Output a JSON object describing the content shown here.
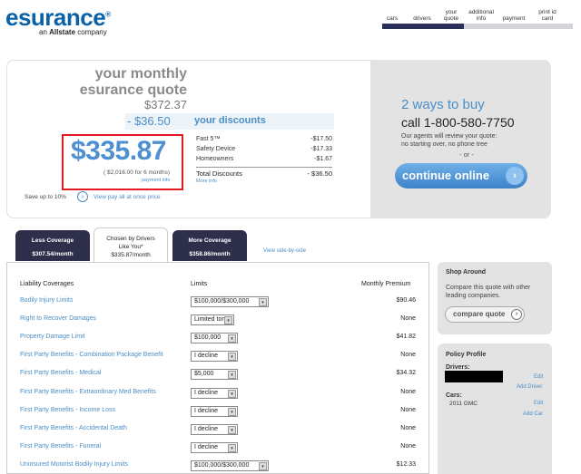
{
  "brand": {
    "logo": "esurance",
    "registered": "®",
    "tagline_prefix": "an ",
    "tagline_brand": "Allstate",
    "tagline_suffix": " company"
  },
  "steps": {
    "items": [
      {
        "label": "cars"
      },
      {
        "label": "drivers"
      },
      {
        "label": "your quote"
      },
      {
        "label": "additional info"
      },
      {
        "label": "payment"
      },
      {
        "label": "print id card"
      }
    ],
    "progress_fraction": 0.43
  },
  "quote": {
    "title": "your monthly esurance quote",
    "original_price": "$372.37",
    "discount_amount": "- $36.50",
    "your_discounts_label": "your discounts",
    "monthly_price": "$335.87",
    "six_months": "( $2,016.00 for 6 months)",
    "payment_info": "payment info",
    "discounts": [
      {
        "name": "Fast 5™",
        "amount": "-$17.50"
      },
      {
        "name": "Safety Device",
        "amount": "-$17.33"
      },
      {
        "name": "Homeowners",
        "amount": "-$1.67"
      }
    ],
    "total_label": "Total Discounts",
    "total_amount": "- $36.50",
    "more_info": "More info",
    "save_text": "Save up to 10%",
    "view_pay_all": "View pay all at once price"
  },
  "buy": {
    "headline": "2 ways to buy",
    "call": "call 1-800-580-7750",
    "agents_line1": "Our agents will review your quote:",
    "agents_line2": "no starting over, no phone tree",
    "or": "- or -",
    "continue_label": "continue online"
  },
  "tabs": [
    {
      "label": "Less Coverage",
      "price": "$307.54/month"
    },
    {
      "label": "Chosen by Drivers Like You*",
      "price": "$335.87/month"
    },
    {
      "label": "More Coverage",
      "price": "$358.86/month"
    }
  ],
  "view_side_by_side": "View side-by-side",
  "coverage": {
    "headers": {
      "name": "Liability Coverages",
      "limits": "Limits",
      "premium": "Monthly Premium"
    },
    "rows": [
      {
        "name": "Bodily Injury Limits",
        "limit": "$100,000/$300,000",
        "premium": "$90.46"
      },
      {
        "name": "Right to Recover Damages",
        "limit": "Limited tort",
        "premium": "None"
      },
      {
        "name": "Property Damage Limit",
        "limit": "$100,000",
        "premium": "$41.82"
      },
      {
        "name": "First Party Benefits - Combination Package Benefit",
        "limit": "I decline",
        "premium": "None"
      },
      {
        "name": "First Party Benefits - Medical",
        "limit": "$5,000",
        "premium": "$34.32"
      },
      {
        "name": "First Party Benefits - Extraordinary Med Benefits",
        "limit": "I decline",
        "premium": "None"
      },
      {
        "name": "First Party Benefits - Income Loss",
        "limit": "I decline",
        "premium": "None"
      },
      {
        "name": "First Party Benefits - Accidental Death",
        "limit": "I decline",
        "premium": "None"
      },
      {
        "name": "First Party Benefits - Funeral",
        "limit": "I decline",
        "premium": "None"
      },
      {
        "name": "Uninsured Motorist Bodily Injury Limits",
        "limit": "$100,000/$300,000",
        "premium": "$12.33"
      }
    ]
  },
  "shop": {
    "title": "Shop Around",
    "text": "Compare this quote with other leading companies.",
    "button": "compare quote"
  },
  "profile": {
    "title": "Policy Profile",
    "drivers_label": "Drivers:",
    "edit1": "Edit",
    "add_driver": "Add Driver",
    "cars_label": "Cars:",
    "car": "2011 GMC",
    "edit2": "Edit",
    "add_car": "Add Car"
  },
  "colors": {
    "accent": "#4a8ec6",
    "brand": "#0a62a8",
    "highlight_box": "#e41b23",
    "tab_dark": "#2d2f4b"
  }
}
